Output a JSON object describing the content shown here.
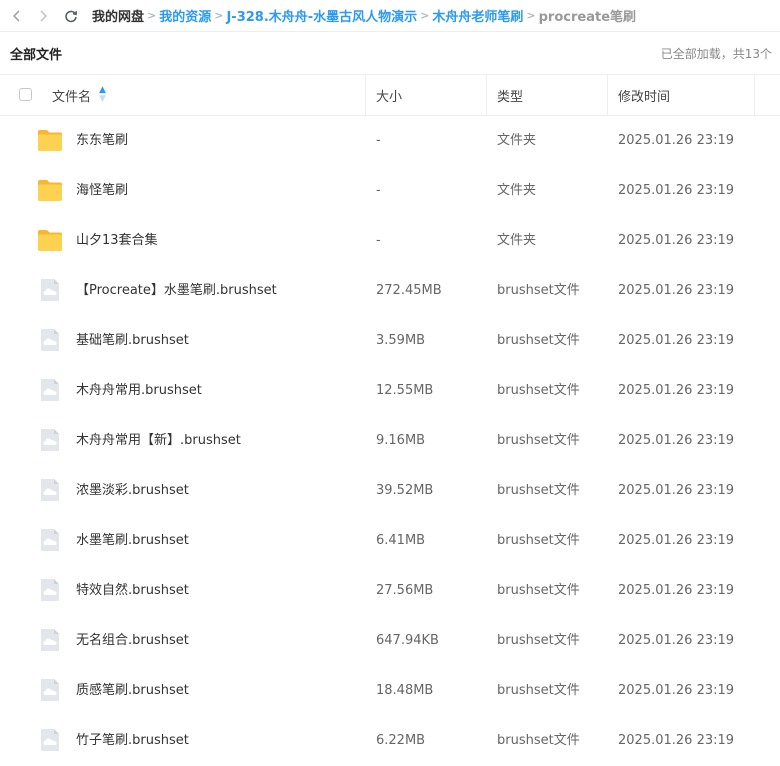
{
  "breadcrumb": {
    "items": [
      "我的网盘",
      "我的资源",
      "J-328.木舟舟-水墨古风人物演示",
      "木舟舟老师笔刷",
      "procreate笔刷"
    ]
  },
  "subbar": {
    "title": "全部文件",
    "status": "已全部加载，共13个"
  },
  "table": {
    "headers": {
      "name": "文件名",
      "size": "大小",
      "type": "类型",
      "mtime": "修改时间"
    },
    "rows": [
      {
        "kind": "folder",
        "name": "东东笔刷",
        "size": "-",
        "type": "文件夹",
        "mtime": "2025.01.26 23:19"
      },
      {
        "kind": "folder",
        "name": "海怪笔刷",
        "size": "-",
        "type": "文件夹",
        "mtime": "2025.01.26 23:19"
      },
      {
        "kind": "folder",
        "name": "山夕13套合集",
        "size": "-",
        "type": "文件夹",
        "mtime": "2025.01.26 23:19"
      },
      {
        "kind": "file",
        "name": "【Procreate】水墨笔刷.brushset",
        "size": "272.45MB",
        "type": "brushset文件",
        "mtime": "2025.01.26 23:19"
      },
      {
        "kind": "file",
        "name": "基础笔刷.brushset",
        "size": "3.59MB",
        "type": "brushset文件",
        "mtime": "2025.01.26 23:19"
      },
      {
        "kind": "file",
        "name": "木舟舟常用.brushset",
        "size": "12.55MB",
        "type": "brushset文件",
        "mtime": "2025.01.26 23:19"
      },
      {
        "kind": "file",
        "name": "木舟舟常用【新】.brushset",
        "size": "9.16MB",
        "type": "brushset文件",
        "mtime": "2025.01.26 23:19"
      },
      {
        "kind": "file",
        "name": "浓墨淡彩.brushset",
        "size": "39.52MB",
        "type": "brushset文件",
        "mtime": "2025.01.26 23:19"
      },
      {
        "kind": "file",
        "name": "水墨笔刷.brushset",
        "size": "6.41MB",
        "type": "brushset文件",
        "mtime": "2025.01.26 23:19"
      },
      {
        "kind": "file",
        "name": "特效自然.brushset",
        "size": "27.56MB",
        "type": "brushset文件",
        "mtime": "2025.01.26 23:19"
      },
      {
        "kind": "file",
        "name": "无名组合.brushset",
        "size": "647.94KB",
        "type": "brushset文件",
        "mtime": "2025.01.26 23:19"
      },
      {
        "kind": "file",
        "name": "质感笔刷.brushset",
        "size": "18.48MB",
        "type": "brushset文件",
        "mtime": "2025.01.26 23:19"
      },
      {
        "kind": "file",
        "name": "竹子笔刷.brushset",
        "size": "6.22MB",
        "type": "brushset文件",
        "mtime": "2025.01.26 23:19"
      }
    ]
  },
  "icons": {
    "folder": "folder-icon",
    "file": "cloud-file-icon",
    "back": "chevron-left-icon",
    "forward": "chevron-right-icon",
    "refresh": "refresh-icon",
    "sort": "sort-icon"
  },
  "colors": {
    "accent": "#2c9af0",
    "folder": "#f7c23a",
    "file_icon_bg": "#e3e6ea"
  }
}
